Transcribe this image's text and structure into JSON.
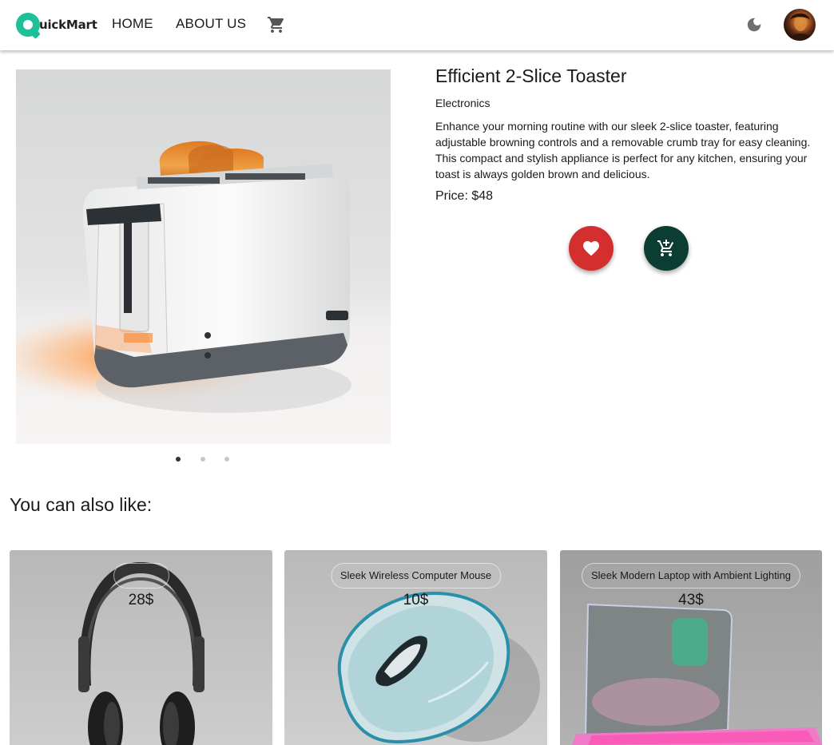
{
  "header": {
    "logo_text": "uickMart",
    "nav": {
      "home": "HOME",
      "about": "ABOUT US"
    },
    "icons": {
      "cart": "cart-icon",
      "theme": "moon-icon",
      "avatar": "user-avatar"
    }
  },
  "product": {
    "title": "Efficient 2-Slice Toaster",
    "category": "Electronics",
    "description": "Enhance your morning routine with our sleek 2-slice toaster, featuring adjustable browning controls and a removable crumb tray for easy cleaning. This compact and stylish appliance is perfect for any kitchen, ensuring your toast is always golden brown and delicious.",
    "price": "Price: $48",
    "image_count": 3,
    "active_image": 1,
    "actions": {
      "favorite_icon": "heart-icon",
      "add_to_cart_icon": "add-cart-icon"
    }
  },
  "recommendations": {
    "heading": "You can also like:",
    "items": [
      {
        "name": "",
        "price": "28$"
      },
      {
        "name": "Sleek Wireless Computer Mouse",
        "price": "10$"
      },
      {
        "name": "Sleek Modern Laptop with Ambient Lighting",
        "price": "43$"
      }
    ]
  },
  "colors": {
    "brand": "#1fbf97",
    "favorite": "#d32f2f",
    "add_to_cart": "#0b3d33"
  }
}
